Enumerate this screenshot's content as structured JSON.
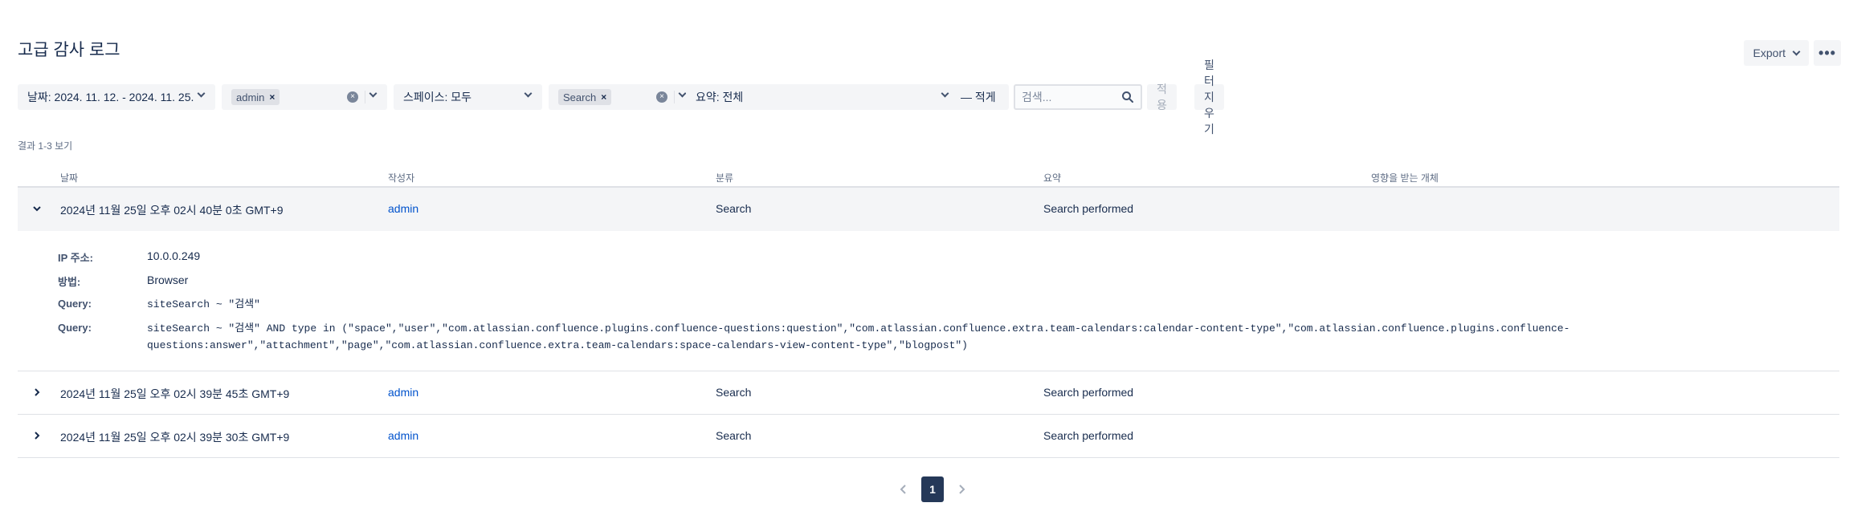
{
  "page": {
    "title": "고급 감사 로그"
  },
  "actions": {
    "export_label": "Export",
    "more_label": "•••"
  },
  "filters": {
    "date_label": "날짜: 2024. 11. 12. - 2024. 11. 25.",
    "author_chip": "admin",
    "space_label": "스페이스: 모두",
    "category_chip": "Search",
    "summary_label": "요약: 전체",
    "coverage_label": "— 적게",
    "search_placeholder": "검색...",
    "apply_label": "적용",
    "clear_label": "필터 지우기"
  },
  "results": {
    "count_text": "결과 1-3 보기"
  },
  "table": {
    "columns": [
      "날짜",
      "작성자",
      "분류",
      "요약",
      "영향을 받는 개체"
    ],
    "rows": [
      {
        "date": "2024년 11월 25일 오후 02시 40분 0초 GMT+9",
        "author": "admin",
        "category": "Search",
        "summary": "Search performed",
        "affected": ""
      },
      {
        "date": "2024년 11월 25일 오후 02시 39분 45초 GMT+9",
        "author": "admin",
        "category": "Search",
        "summary": "Search performed",
        "affected": ""
      },
      {
        "date": "2024년 11월 25일 오후 02시 39분 30초 GMT+9",
        "author": "admin",
        "category": "Search",
        "summary": "Search performed",
        "affected": ""
      }
    ],
    "details": {
      "ip_label": "IP 주소:",
      "ip_value": "10.0.0.249",
      "method_label": "방법:",
      "method_value": "Browser",
      "query1_label": "Query:",
      "query1_value": "siteSearch ~ \"검색\"",
      "query2_label": "Query:",
      "query2_line1": "siteSearch ~ \"검색\" AND type in (\"space\",\"user\",\"com.atlassian.confluence.plugins.confluence-questions:question\",\"com.atlassian.confluence.extra.team-calendars:calendar-content-type\",\"com.atlassian.confluence.plugins.confluence-",
      "query2_line2": "questions:answer\",\"attachment\",\"page\",\"com.atlassian.confluence.extra.team-calendars:space-calendars-view-content-type\",\"blogpost\")"
    }
  },
  "pagination": {
    "current_page": "1"
  }
}
